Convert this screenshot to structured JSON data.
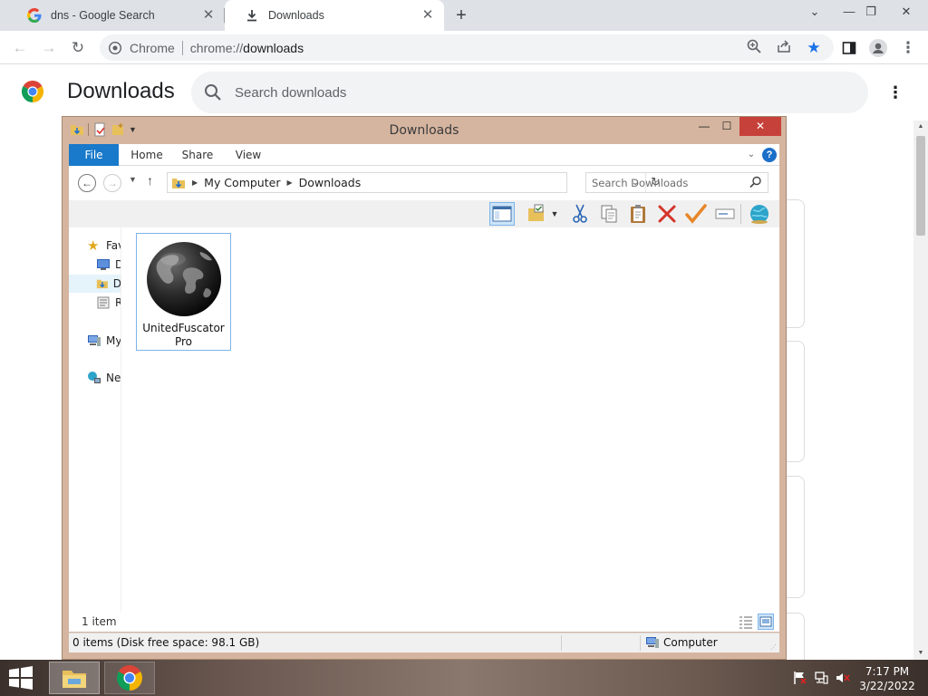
{
  "browser": {
    "tabs": [
      {
        "title": "dns - Google Search",
        "active": false
      },
      {
        "title": "Downloads",
        "active": true
      }
    ],
    "omnibox": {
      "chip_label": "Chrome",
      "url_scheme": "chrome://",
      "url_host": "downloads"
    }
  },
  "downloads_page": {
    "title": "Downloads",
    "search_placeholder": "Search downloads"
  },
  "explorer": {
    "title": "Downloads",
    "ribbon_tabs": [
      "File",
      "Home",
      "Share",
      "View"
    ],
    "breadcrumb": [
      "My Computer",
      "Downloads"
    ],
    "search_placeholder": "Search Downloads",
    "nav_pane": [
      {
        "label": "Fav",
        "icon": "star-icon"
      },
      {
        "label": "D",
        "icon": "desktop-icon"
      },
      {
        "label": "D",
        "icon": "downloads-folder-icon"
      },
      {
        "label": "R",
        "icon": "recent-places-icon"
      },
      {
        "label": "My",
        "icon": "computer-icon"
      },
      {
        "label": "Ne",
        "icon": "network-icon"
      }
    ],
    "files": [
      {
        "name": "UnitedFuscatorPro",
        "icon": "globe-icon"
      }
    ],
    "item_count": "1 item",
    "status_left": "0 items (Disk free space: 98.1 GB)",
    "status_right": "Computer"
  },
  "taskbar": {
    "time": "7:17 PM",
    "date": "3/22/2022"
  },
  "colors": {
    "tabstrip_bg": "#dee1e6",
    "explorer_frame": "#d5b5a0",
    "close_button": "#c7413b",
    "file_tab_blue": "#1979ca",
    "selection_border": "#7eb4ea"
  }
}
